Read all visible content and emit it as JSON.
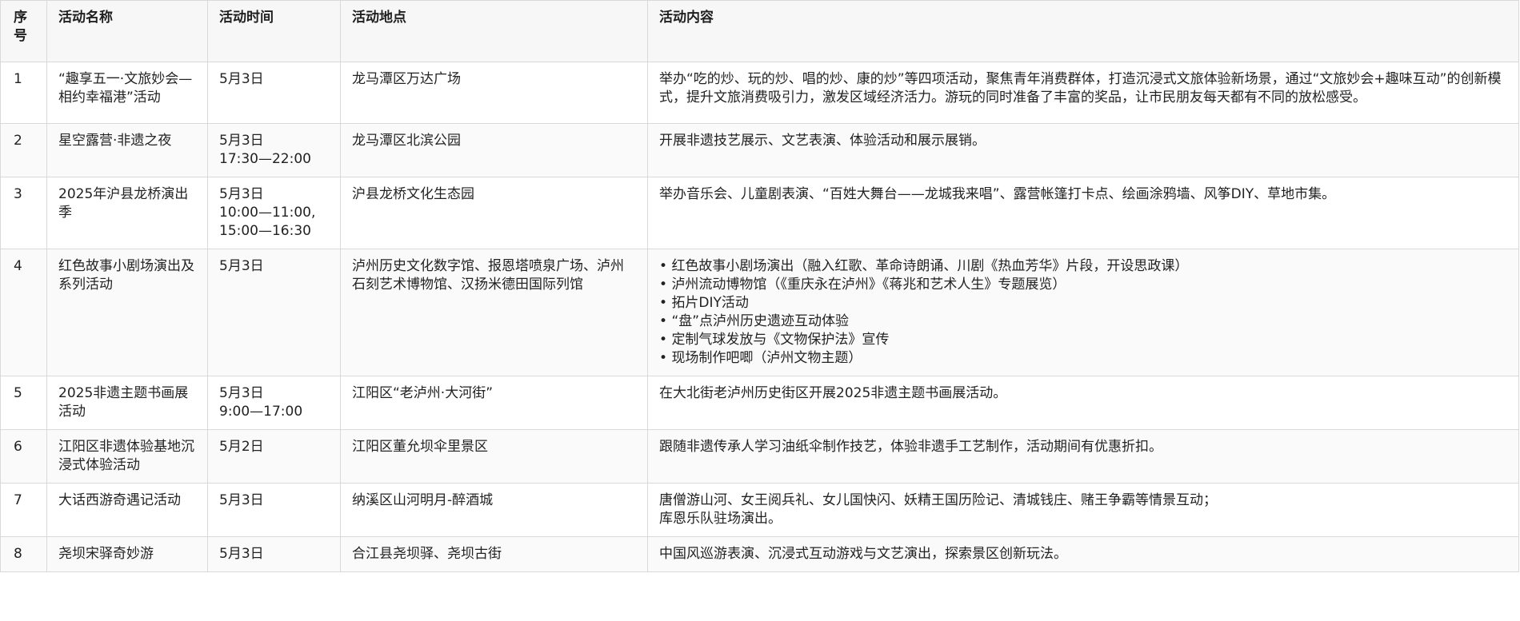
{
  "table": {
    "headers": {
      "no": "序号",
      "name": "活动名称",
      "time": "活动时间",
      "place": "活动地点",
      "content": "活动内容"
    },
    "rows": [
      {
        "no": "1",
        "name": "“趣享五一·文旅妙会—相约幸福港”活动",
        "time": [
          "5月3日"
        ],
        "place": "龙马潭区万达广场",
        "content": [
          "举办“吃的炒、玩的炒、唱的炒、康的炒”等四项活动，聚焦青年消费群体，打造沉浸式文旅体验新场景，通过“文旅妙会+趣味互动”的创新模式，提升文旅消费吸引力，激发区域经济活力。游玩的同时准备了丰富的奖品，让市民朋友每天都有不同的放松感受。"
        ]
      },
      {
        "no": "2",
        "name": "星空露营·非遗之夜",
        "time": [
          "5月3日",
          "17:30—22:00"
        ],
        "place": "龙马潭区北滨公园",
        "content": [
          "开展非遗技艺展示、文艺表演、体验活动和展示展销。"
        ]
      },
      {
        "no": "3",
        "name": "2025年沪县龙桥演出季",
        "time": [
          "5月3日",
          "10:00—11:00,",
          "15:00—16:30"
        ],
        "place": "沪县龙桥文化生态园",
        "content": [
          "举办音乐会、儿童剧表演、“百姓大舞台——龙城我来唱”、露营帐篷打卡点、绘画涂鸦墙、风筝DIY、草地市集。"
        ]
      },
      {
        "no": "4",
        "name": "红色故事小剧场演出及系列活动",
        "time": [
          "5月3日"
        ],
        "place": "泸州历史文化数字馆、报恩塔喷泉广场、泸州石刻艺术博物馆、汉扬米德田国际列馆",
        "bullets": [
          "红色故事小剧场演出（融入红歌、革命诗朗诵、川剧《热血芳华》片段，开设思政课）",
          "泸州流动博物馆（《重庆永在泸州》《蒋兆和艺术人生》专题展览）",
          "拓片DIY活动",
          "“盘”点泸州历史遗迹互动体验",
          "定制气球发放与《文物保护法》宣传",
          "现场制作吧唧（泸州文物主题）"
        ]
      },
      {
        "no": "5",
        "name": "2025非遗主题书画展活动",
        "time": [
          "5月3日",
          "9:00—17:00"
        ],
        "place": "江阳区“老泸州·大河街”",
        "content": [
          "在大北街老泸州历史街区开展2025非遗主题书画展活动。"
        ]
      },
      {
        "no": "6",
        "name": "江阳区非遗体验基地沉浸式体验活动",
        "time": [
          "5月2日"
        ],
        "place": "江阳区董允坝伞里景区",
        "content": [
          "跟随非遗传承人学习油纸伞制作技艺，体验非遗手工艺制作，活动期间有优惠折扣。"
        ]
      },
      {
        "no": "7",
        "name": "大话西游奇遇记活动",
        "time": [
          "5月3日"
        ],
        "place": "纳溪区山河明月-醉酒城",
        "content": [
          "唐僧游山河、女王阅兵礼、女儿国快闪、妖精王国历险记、清城钱庄、赌王争霸等情景互动；",
          "库恩乐队驻场演出。"
        ]
      },
      {
        "no": "8",
        "name": "尧坝宋驿奇妙游",
        "time": [
          "5月3日"
        ],
        "place": "合江县尧坝驿、尧坝古街",
        "content": [
          "中国风巡游表演、沉浸式互动游戏与文艺演出，探索景区创新玩法。"
        ]
      }
    ]
  }
}
